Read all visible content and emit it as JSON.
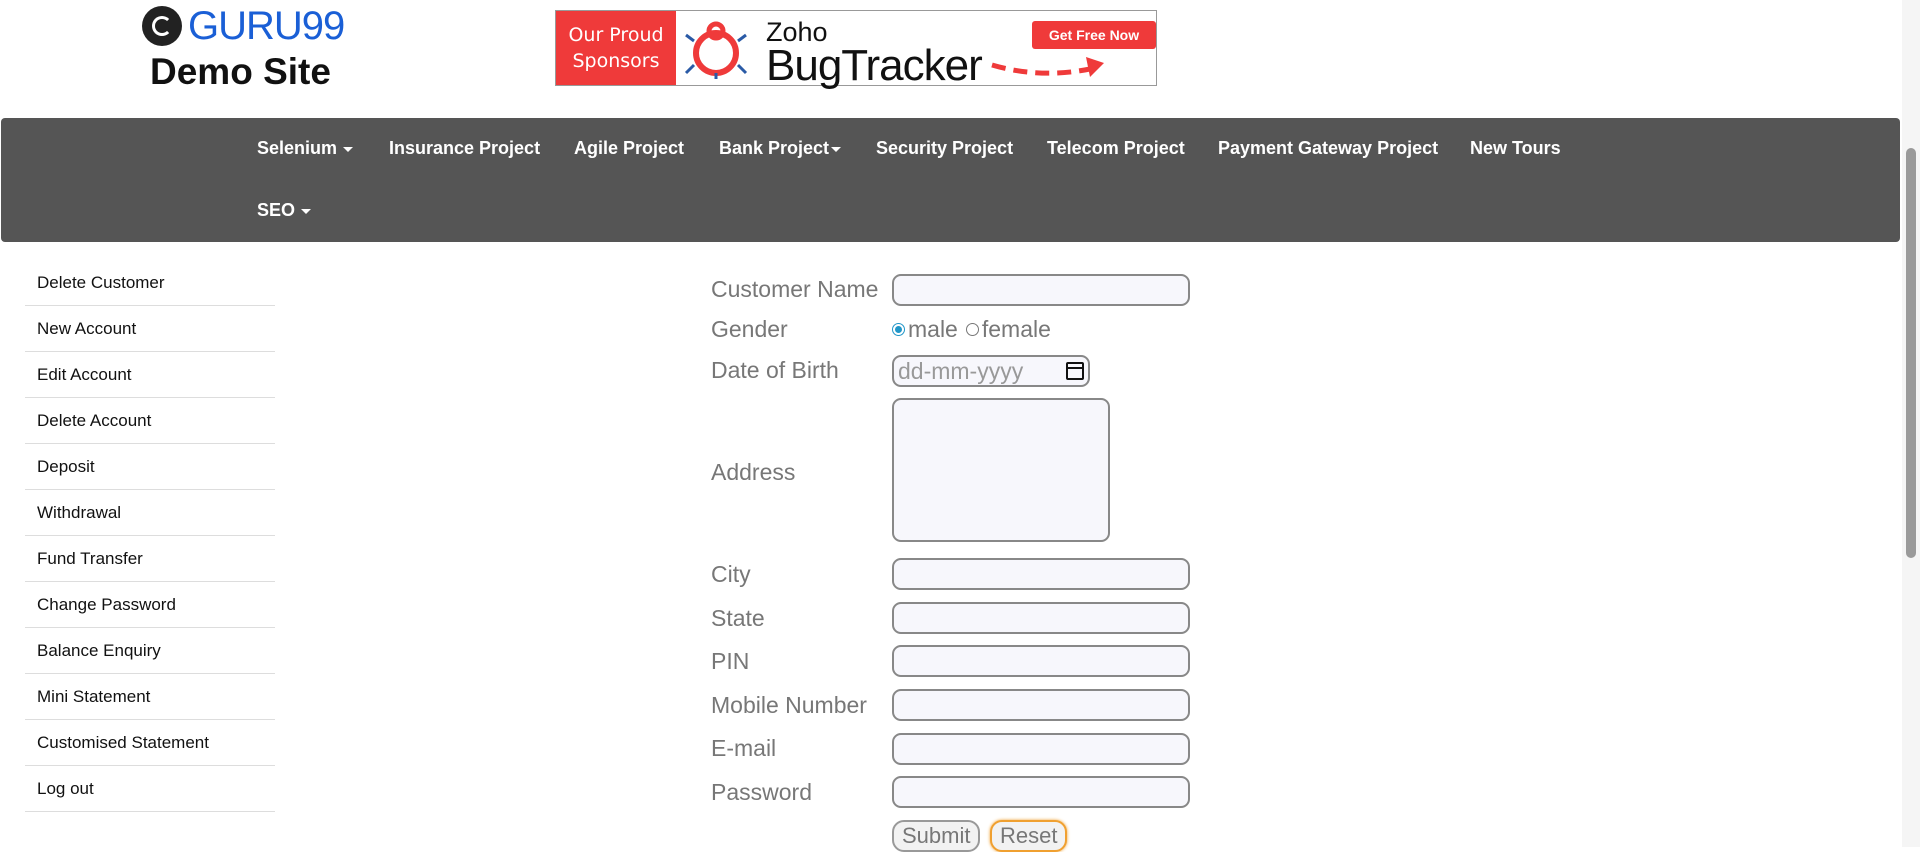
{
  "header": {
    "logo_text": "GURU99",
    "logo_sub": "Demo Site",
    "banner": {
      "sponsor_line1": "Our Proud",
      "sponsor_line2": "Sponsors",
      "zoho": "Zoho",
      "product": "BugTracker",
      "cta": "Get Free Now"
    }
  },
  "nav": {
    "items": [
      {
        "label": "Selenium",
        "dropdown": true
      },
      {
        "label": "Insurance Project"
      },
      {
        "label": "Agile Project"
      },
      {
        "label": "Bank Project",
        "dropdown": true
      },
      {
        "label": "Security Project"
      },
      {
        "label": "Telecom Project"
      },
      {
        "label": "Payment Gateway Project"
      },
      {
        "label": "New Tours"
      },
      {
        "label": "SEO",
        "dropdown": true
      }
    ]
  },
  "sidebar": {
    "items": [
      {
        "label": "Delete Customer"
      },
      {
        "label": "New Account"
      },
      {
        "label": "Edit Account"
      },
      {
        "label": "Delete Account"
      },
      {
        "label": "Deposit"
      },
      {
        "label": "Withdrawal"
      },
      {
        "label": "Fund Transfer"
      },
      {
        "label": "Change Password"
      },
      {
        "label": "Balance Enquiry"
      },
      {
        "label": "Mini Statement"
      },
      {
        "label": "Customised Statement"
      },
      {
        "label": "Log out"
      }
    ]
  },
  "form": {
    "customer_name_label": "Customer Name",
    "gender_label": "Gender",
    "gender_male": "male",
    "gender_female": "female",
    "gender_selected": "male",
    "dob_label": "Date of Birth",
    "dob_placeholder": "dd-mm-yyyy",
    "address_label": "Address",
    "city_label": "City",
    "state_label": "State",
    "pin_label": "PIN",
    "mobile_label": "Mobile Number",
    "email_label": "E-mail",
    "password_label": "Password",
    "submit_label": "Submit",
    "reset_label": "Reset"
  },
  "colors": {
    "nav_bg": "#555555",
    "logo_blue": "#1a5fd6",
    "banner_red": "#ef3a3a"
  }
}
